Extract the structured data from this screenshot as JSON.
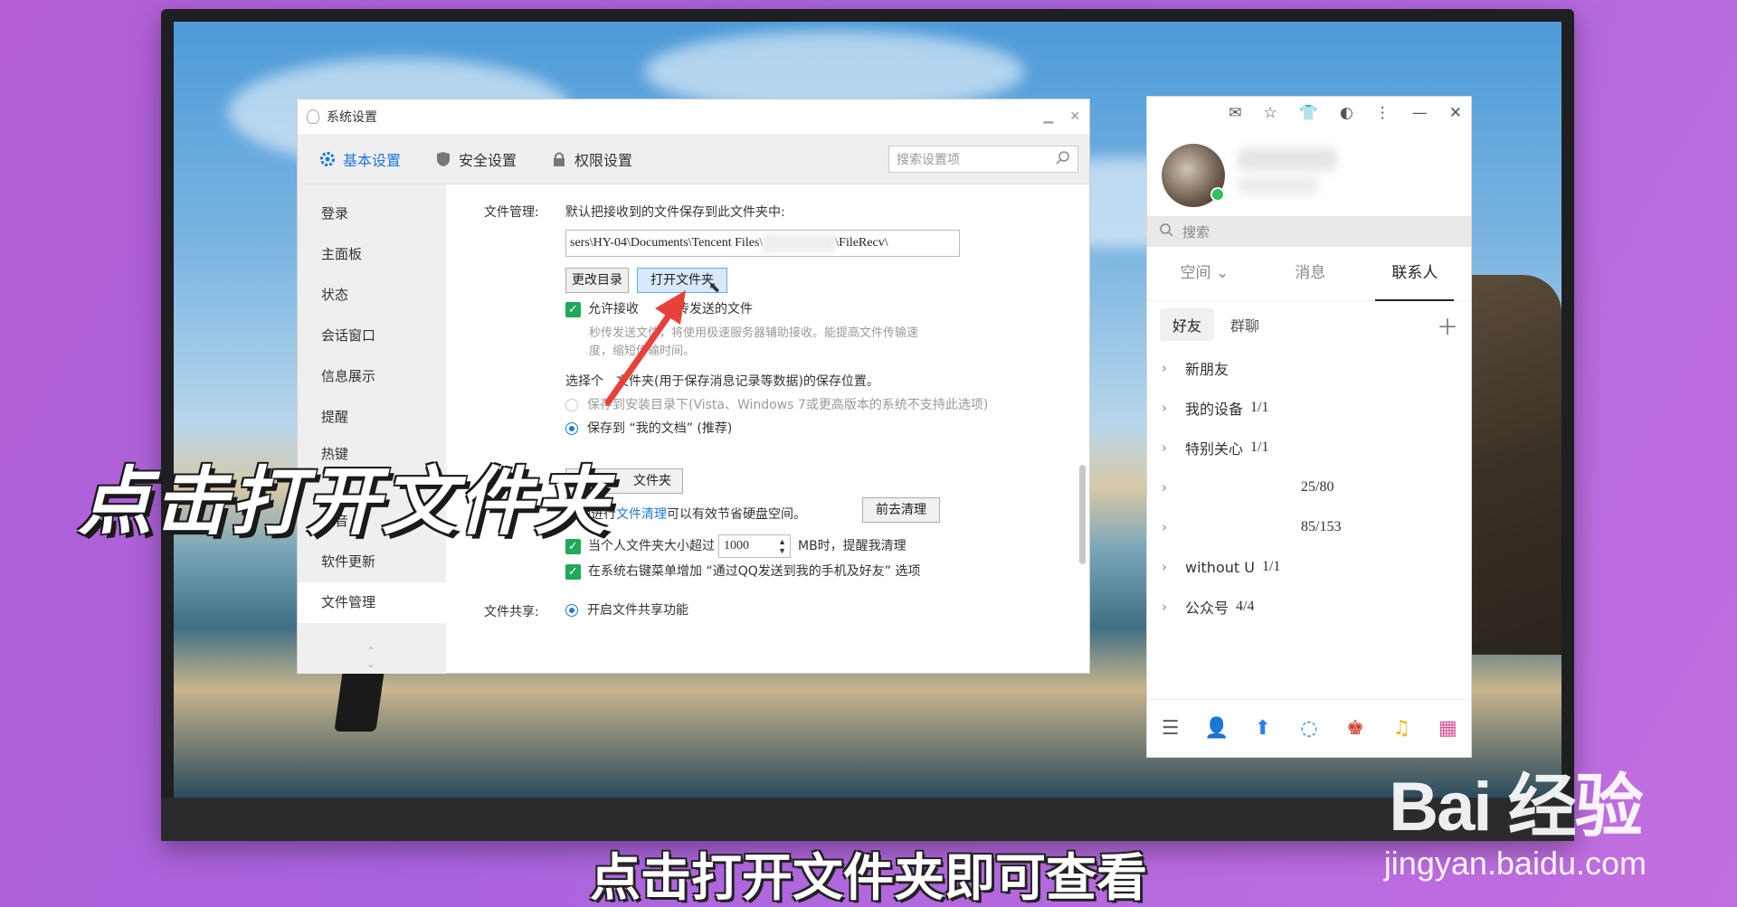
{
  "settings": {
    "title": "系统设置",
    "tabs": [
      {
        "label": "基本设置"
      },
      {
        "label": "安全设置"
      },
      {
        "label": "权限设置"
      }
    ],
    "search_placeholder": "搜索设置项",
    "nav": [
      "登录",
      "主面板",
      "状态",
      "会话窗口",
      "信息展示",
      "提醒",
      "热键",
      "",
      "声音",
      "软件更新",
      "文件管理"
    ],
    "file_mgmt_label": "文件管理:",
    "file_mgmt_desc": "默认把接收到的文件保存到此文件夹中:",
    "path_value": "sers\\HY-04\\Documents\\Tencent Files\\",
    "path_suffix": "\\FileRecv\\",
    "change_dir_btn": "更改目录",
    "open_folder_btn": "打开文件夹",
    "allow_receive": "允许接收通过秒传发送的文件",
    "allow_receive_visible": "允许接收",
    "allow_receive_tail": "秒传发送的文件",
    "allow_receive_note1": "秒传发送文件，将使用极速服务器辅助接收。能提高文件传输速",
    "allow_receive_note2": "度，缩短传输时间。",
    "select_personal_folder": "选择个人文件夹(用于保存消息记录等数据)的保存位置。",
    "select_personal_left": "选择个",
    "select_personal_right": "文件夹(用于保存消息记录等数据)的保存位置。",
    "radio_install_dir": "保存到安装目录下(Vista、Windows 7或更高版本的系统不支持此选项)",
    "radio_my_docs": "保存到 “我的文档” (推荐)",
    "open_personal_btn": "文件夹",
    "cleanup_text_prefix": "定期进行",
    "cleanup_link": "文件清理",
    "cleanup_text_suffix": "可以有效节省硬盘空间。",
    "cleanup_btn": "前去清理",
    "size_chk_prefix": "当个人文件夹大小超过",
    "size_value": "1000",
    "size_chk_suffix": "MB时，提醒我清理",
    "context_menu_chk": "在系统右键菜单增加 “通过QQ发送到我的手机及好友” 选项",
    "file_share_label": "文件共享:",
    "file_share_radio": "开启文件共享功能"
  },
  "qq": {
    "search_placeholder": "搜索",
    "tabs": [
      {
        "label": "空间"
      },
      {
        "label": "消息"
      },
      {
        "label": "联系人"
      }
    ],
    "subtabs": [
      {
        "label": "好友"
      },
      {
        "label": "群聊"
      }
    ],
    "groups": [
      {
        "name": "新朋友",
        "count": ""
      },
      {
        "name": "我的设备",
        "count": "1/1"
      },
      {
        "name": "特别关心",
        "count": "1/1"
      },
      {
        "name": "",
        "count": "25/80"
      },
      {
        "name": "",
        "count": "85/153"
      },
      {
        "name": "without U",
        "count": "1/1"
      },
      {
        "name": "公众号",
        "count": "4/4"
      }
    ]
  },
  "overlay_title": "点击打开文件夹",
  "caption": "点击打开文件夹即可查看",
  "watermark": {
    "logo": "Bai 经验",
    "url": "jingyan.baidu.com"
  },
  "colors": {
    "accent": "#1e7ad6",
    "checkbox": "#21a95b",
    "online": "#2dc160",
    "arrow": "#e8413a"
  }
}
